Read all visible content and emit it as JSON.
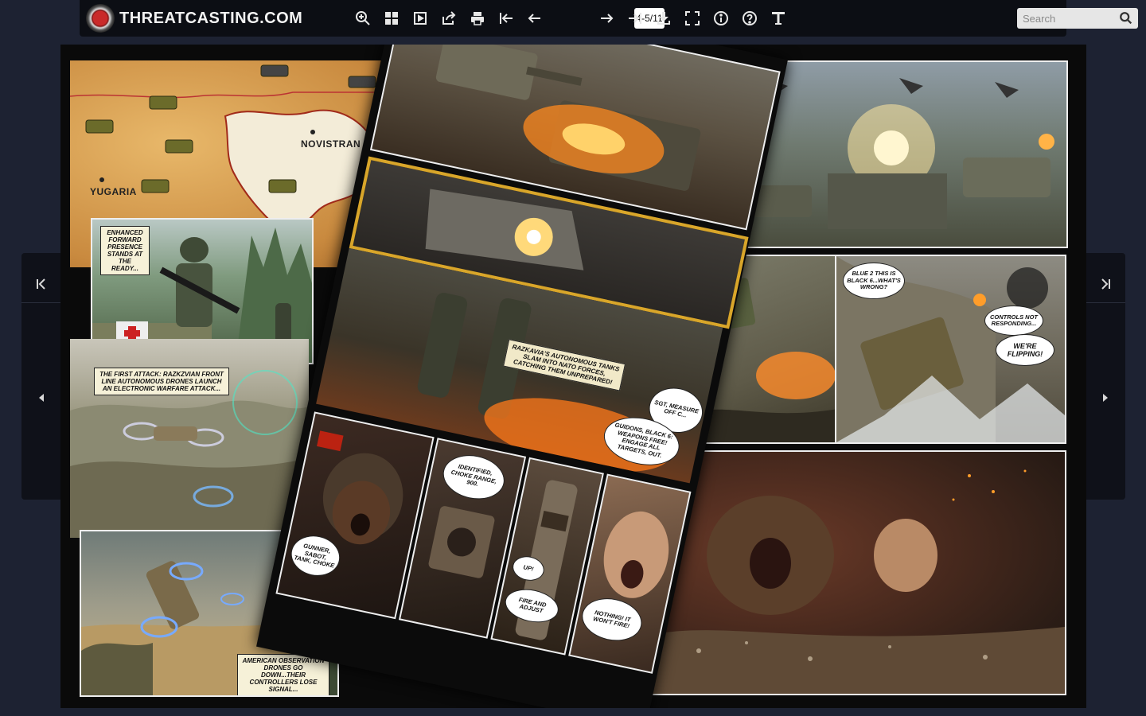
{
  "app": {
    "brand": "THREATCASTING.COM"
  },
  "toolbar": {
    "page_indicator": "4-5/11",
    "search_placeholder": "Search",
    "buttons": [
      {
        "name": "zoom-in-icon"
      },
      {
        "name": "thumbnails-icon"
      },
      {
        "name": "single-page-icon"
      },
      {
        "name": "share-icon"
      },
      {
        "name": "print-icon"
      },
      {
        "name": "first-page-icon"
      },
      {
        "name": "previous-page-icon"
      },
      {
        "name": "next-page-icon"
      },
      {
        "name": "last-page-icon"
      },
      {
        "name": "download-icon"
      },
      {
        "name": "fullscreen-icon"
      },
      {
        "name": "info-icon"
      },
      {
        "name": "help-icon"
      },
      {
        "name": "text-icon"
      }
    ]
  },
  "map": {
    "label_yugaria": "YUGARIA",
    "label_novistrana": "NOVISTRAN"
  },
  "left_page": {
    "caption_1": "ENHANCED FORWARD PRESENCE STANDS AT THE READY...",
    "caption_2": "THE FIRST ATTACK: RAZKZVIAN FRONT LINE AUTONOMOUS DRONES LAUNCH AN ELECTRONIC WARFARE ATTACK...",
    "caption_3": "AMERICAN OBSERVATION DRONES GO DOWN...THEIR CONTROLLERS LOSE SIGNAL..."
  },
  "middle_page": {
    "caption_1": "RAZKAVIA'S AUTONOMOUS TANKS SLAM INTO NATO FORCES, CATCHING THEM UNPREPARED!",
    "bubble_sgt": "SGT, MEASURE OFF C...",
    "bubble_guidons": "GUIDONS, BLACK 6: WEAPONS FREE! ENGAGE ALL TARGETS, OUT.",
    "bubble_gunner": "GUNNER, SABOT, TANK, CHOKE",
    "bubble_identified": "IDENTIFIED, CHOKE RANGE, 900.",
    "bubble_up": "UP!",
    "bubble_fire": "FIRE AND ADJUST",
    "bubble_nothing": "NOTHING! IT WON'T FIRE!"
  },
  "right_page": {
    "bubble_blue2": "BLUE 2 THIS IS BLACK 6...WHAT'S WRONG?",
    "bubble_controls": "CONTROLS NOT RESPONDING...",
    "bubble_flipping": "WE'RE FLIPPING!"
  },
  "colors": {
    "background": "#1d2232",
    "toolbar": "#0c0e14",
    "sidenav": "#0f1119",
    "map_bg": "#d9a45a",
    "map_land": "#f3ecd8",
    "fire": "#ff9d2a"
  }
}
